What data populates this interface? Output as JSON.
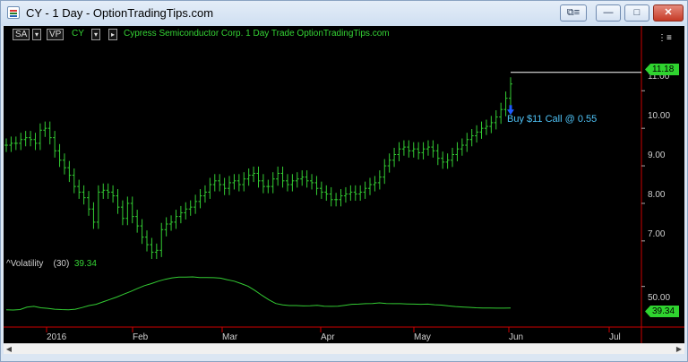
{
  "window": {
    "title": "CY - 1 Day - OptionTradingTips.com",
    "buttons": {
      "extra": "⧉≡",
      "minimize": "—",
      "maximize": "□",
      "close": "✕"
    }
  },
  "toolbar": {
    "sa": "SA",
    "vp": "VP",
    "symbol": "CY",
    "description": "Cypress Semiconductor Corp.  1 Day  Trade  OptionTradingTips.com"
  },
  "annotation": "Buy $11 Call @ 0.55",
  "volatility_label": {
    "name": "^Volatility",
    "period": "(30)",
    "value": "39.34"
  },
  "price_labels": [
    "11.00",
    "10.00",
    "9.00",
    "8.00",
    "7.00",
    "50.00"
  ],
  "badges": {
    "last_price": "11.18",
    "volatility": "39.34"
  },
  "months": [
    "2016",
    "Feb",
    "Mar",
    "Apr",
    "May",
    "Jun",
    "Jul"
  ],
  "colors": {
    "bars": "#33cc33",
    "grid_red": "#cc0000",
    "arrow": "#1e5bff",
    "annotation": "#4fc3f7"
  },
  "chart_data": {
    "type": "line",
    "ticker": "CY",
    "y_ticks": [
      7.0,
      8.0,
      9.0,
      10.0,
      11.0
    ],
    "ylim": [
      6.4,
      12.2
    ],
    "last_price": 11.18,
    "close": [
      9.55,
      9.6,
      9.6,
      9.7,
      9.75,
      9.7,
      9.6,
      9.95,
      10.0,
      9.75,
      9.4,
      9.15,
      8.95,
      8.75,
      8.45,
      8.3,
      8.15,
      7.85,
      7.5,
      8.3,
      8.35,
      8.3,
      8.2,
      7.9,
      7.6,
      8.0,
      7.65,
      7.4,
      7.1,
      6.9,
      6.7,
      6.75,
      7.3,
      7.45,
      7.5,
      7.65,
      7.75,
      7.85,
      7.9,
      8.05,
      8.2,
      8.3,
      8.5,
      8.6,
      8.5,
      8.4,
      8.55,
      8.6,
      8.5,
      8.65,
      8.75,
      8.8,
      8.6,
      8.45,
      8.45,
      8.65,
      8.8,
      8.6,
      8.5,
      8.6,
      8.65,
      8.7,
      8.6,
      8.55,
      8.4,
      8.3,
      8.25,
      8.1,
      8.1,
      8.2,
      8.25,
      8.3,
      8.25,
      8.3,
      8.4,
      8.5,
      8.55,
      8.7,
      9.0,
      9.15,
      9.3,
      9.45,
      9.5,
      9.4,
      9.45,
      9.35,
      9.45,
      9.5,
      9.4,
      9.2,
      9.1,
      9.15,
      9.3,
      9.45,
      9.55,
      9.7,
      9.8,
      9.9,
      10.0,
      10.05,
      10.15,
      10.3,
      10.5,
      10.8,
      11.18
    ],
    "volatility": {
      "name": "^Volatility",
      "period": 30,
      "last": 39.34,
      "ref_level": 50.0,
      "ylim": [
        30,
        60
      ],
      "values": [
        38.5,
        38.4,
        38.6,
        39.8,
        40.2,
        39.5,
        39.2,
        38.8,
        38.6,
        38.5,
        38.8,
        39.6,
        40.6,
        41.2,
        42.4,
        43.6,
        44.8,
        46.2,
        47.5,
        49.0,
        50.4,
        51.4,
        52.6,
        53.5,
        54.2,
        54.6,
        54.6,
        54.7,
        54.4,
        54.4,
        54.3,
        54.1,
        53.3,
        52.6,
        51.4,
        50.1,
        48.0,
        45.6,
        43.4,
        41.6,
        40.9,
        40.6,
        40.6,
        40.4,
        40.5,
        40.7,
        40.3,
        40.2,
        40.3,
        40.7,
        41.2,
        41.3,
        41.5,
        41.6,
        41.9,
        41.6,
        41.5,
        41.5,
        41.4,
        41.3,
        41.2,
        41.3,
        41.0,
        40.8,
        40.4,
        40.1,
        39.9,
        39.7,
        39.5,
        39.4,
        39.4,
        39.3,
        39.3,
        39.34
      ]
    }
  }
}
